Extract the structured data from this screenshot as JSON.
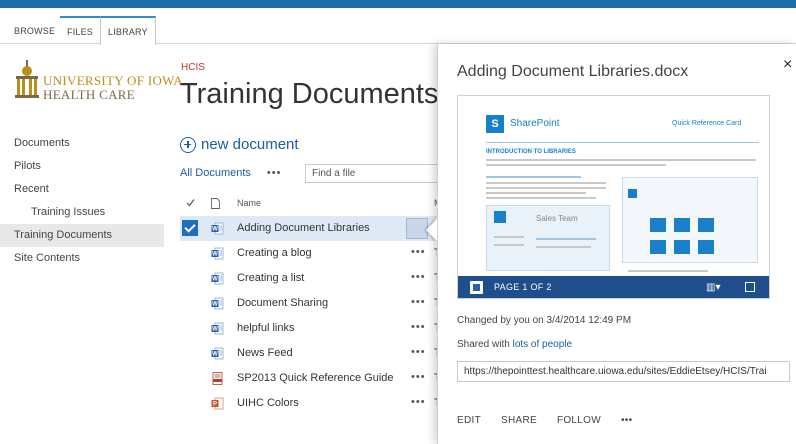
{
  "ribbon": {
    "tabs": [
      "BROWSE",
      "FILES",
      "LIBRARY"
    ]
  },
  "brand": {
    "line1": "UNIVERSITY OF IOWA",
    "line2": "HEALTH CARE"
  },
  "left_nav": [
    {
      "label": "Documents",
      "sub": false,
      "selected": false
    },
    {
      "label": "Pilots",
      "sub": false,
      "selected": false
    },
    {
      "label": "Recent",
      "sub": false,
      "selected": false
    },
    {
      "label": "Training Issues",
      "sub": true,
      "selected": false
    },
    {
      "label": "Training Documents",
      "sub": false,
      "selected": true
    },
    {
      "label": "Site Contents",
      "sub": false,
      "selected": false
    }
  ],
  "site_label": "HCIS",
  "page_title": "Training Documents",
  "new_document": "new document",
  "view": {
    "current": "All Documents",
    "more": "•••",
    "find_placeholder": "Find a file"
  },
  "table": {
    "name_header": "Name",
    "truncated_header": "M",
    "rows": [
      {
        "name": "Adding Document Libraries",
        "type": "word",
        "selected": true,
        "trunc": ""
      },
      {
        "name": "Creating a blog",
        "type": "word",
        "selected": false,
        "trunc": "T"
      },
      {
        "name": "Creating a list",
        "type": "word",
        "selected": false,
        "trunc": "T"
      },
      {
        "name": "Document Sharing",
        "type": "word",
        "selected": false,
        "trunc": "T"
      },
      {
        "name": "helpful links",
        "type": "word",
        "selected": false,
        "trunc": "T"
      },
      {
        "name": "News Feed",
        "type": "word",
        "selected": false,
        "trunc": "T"
      },
      {
        "name": "SP2013 Quick Reference Guide",
        "type": "pdf",
        "selected": false,
        "trunc": "T"
      },
      {
        "name": "UIHC Colors",
        "type": "ppt",
        "selected": false,
        "trunc": "T"
      }
    ],
    "row_menu": "•••"
  },
  "callout": {
    "title": "Adding Document Libraries.docx",
    "close": "×",
    "preview": {
      "brand": "SharePoint",
      "brand_mark": "S",
      "quick_ref": "Quick Reference Card",
      "heading": "INTRODUCTION TO LIBRARIES",
      "sales": "Sales Team",
      "page": "PAGE 1 OF 2"
    },
    "changed": "Changed by you on 3/4/2014 12:49 PM",
    "shared_prefix": "Shared with ",
    "shared_link": "lots of people",
    "url": "https://thepointtest.healthcare.uiowa.edu/sites/EddieEtsey/HCIS/Trai",
    "actions": [
      "EDIT",
      "SHARE",
      "FOLLOW",
      "•••"
    ]
  },
  "colors": {
    "accent": "#1a5fa0",
    "site_label": "#c0392b",
    "preview_footer": "#1f4e8c",
    "brand_gold": "#b8901a"
  }
}
